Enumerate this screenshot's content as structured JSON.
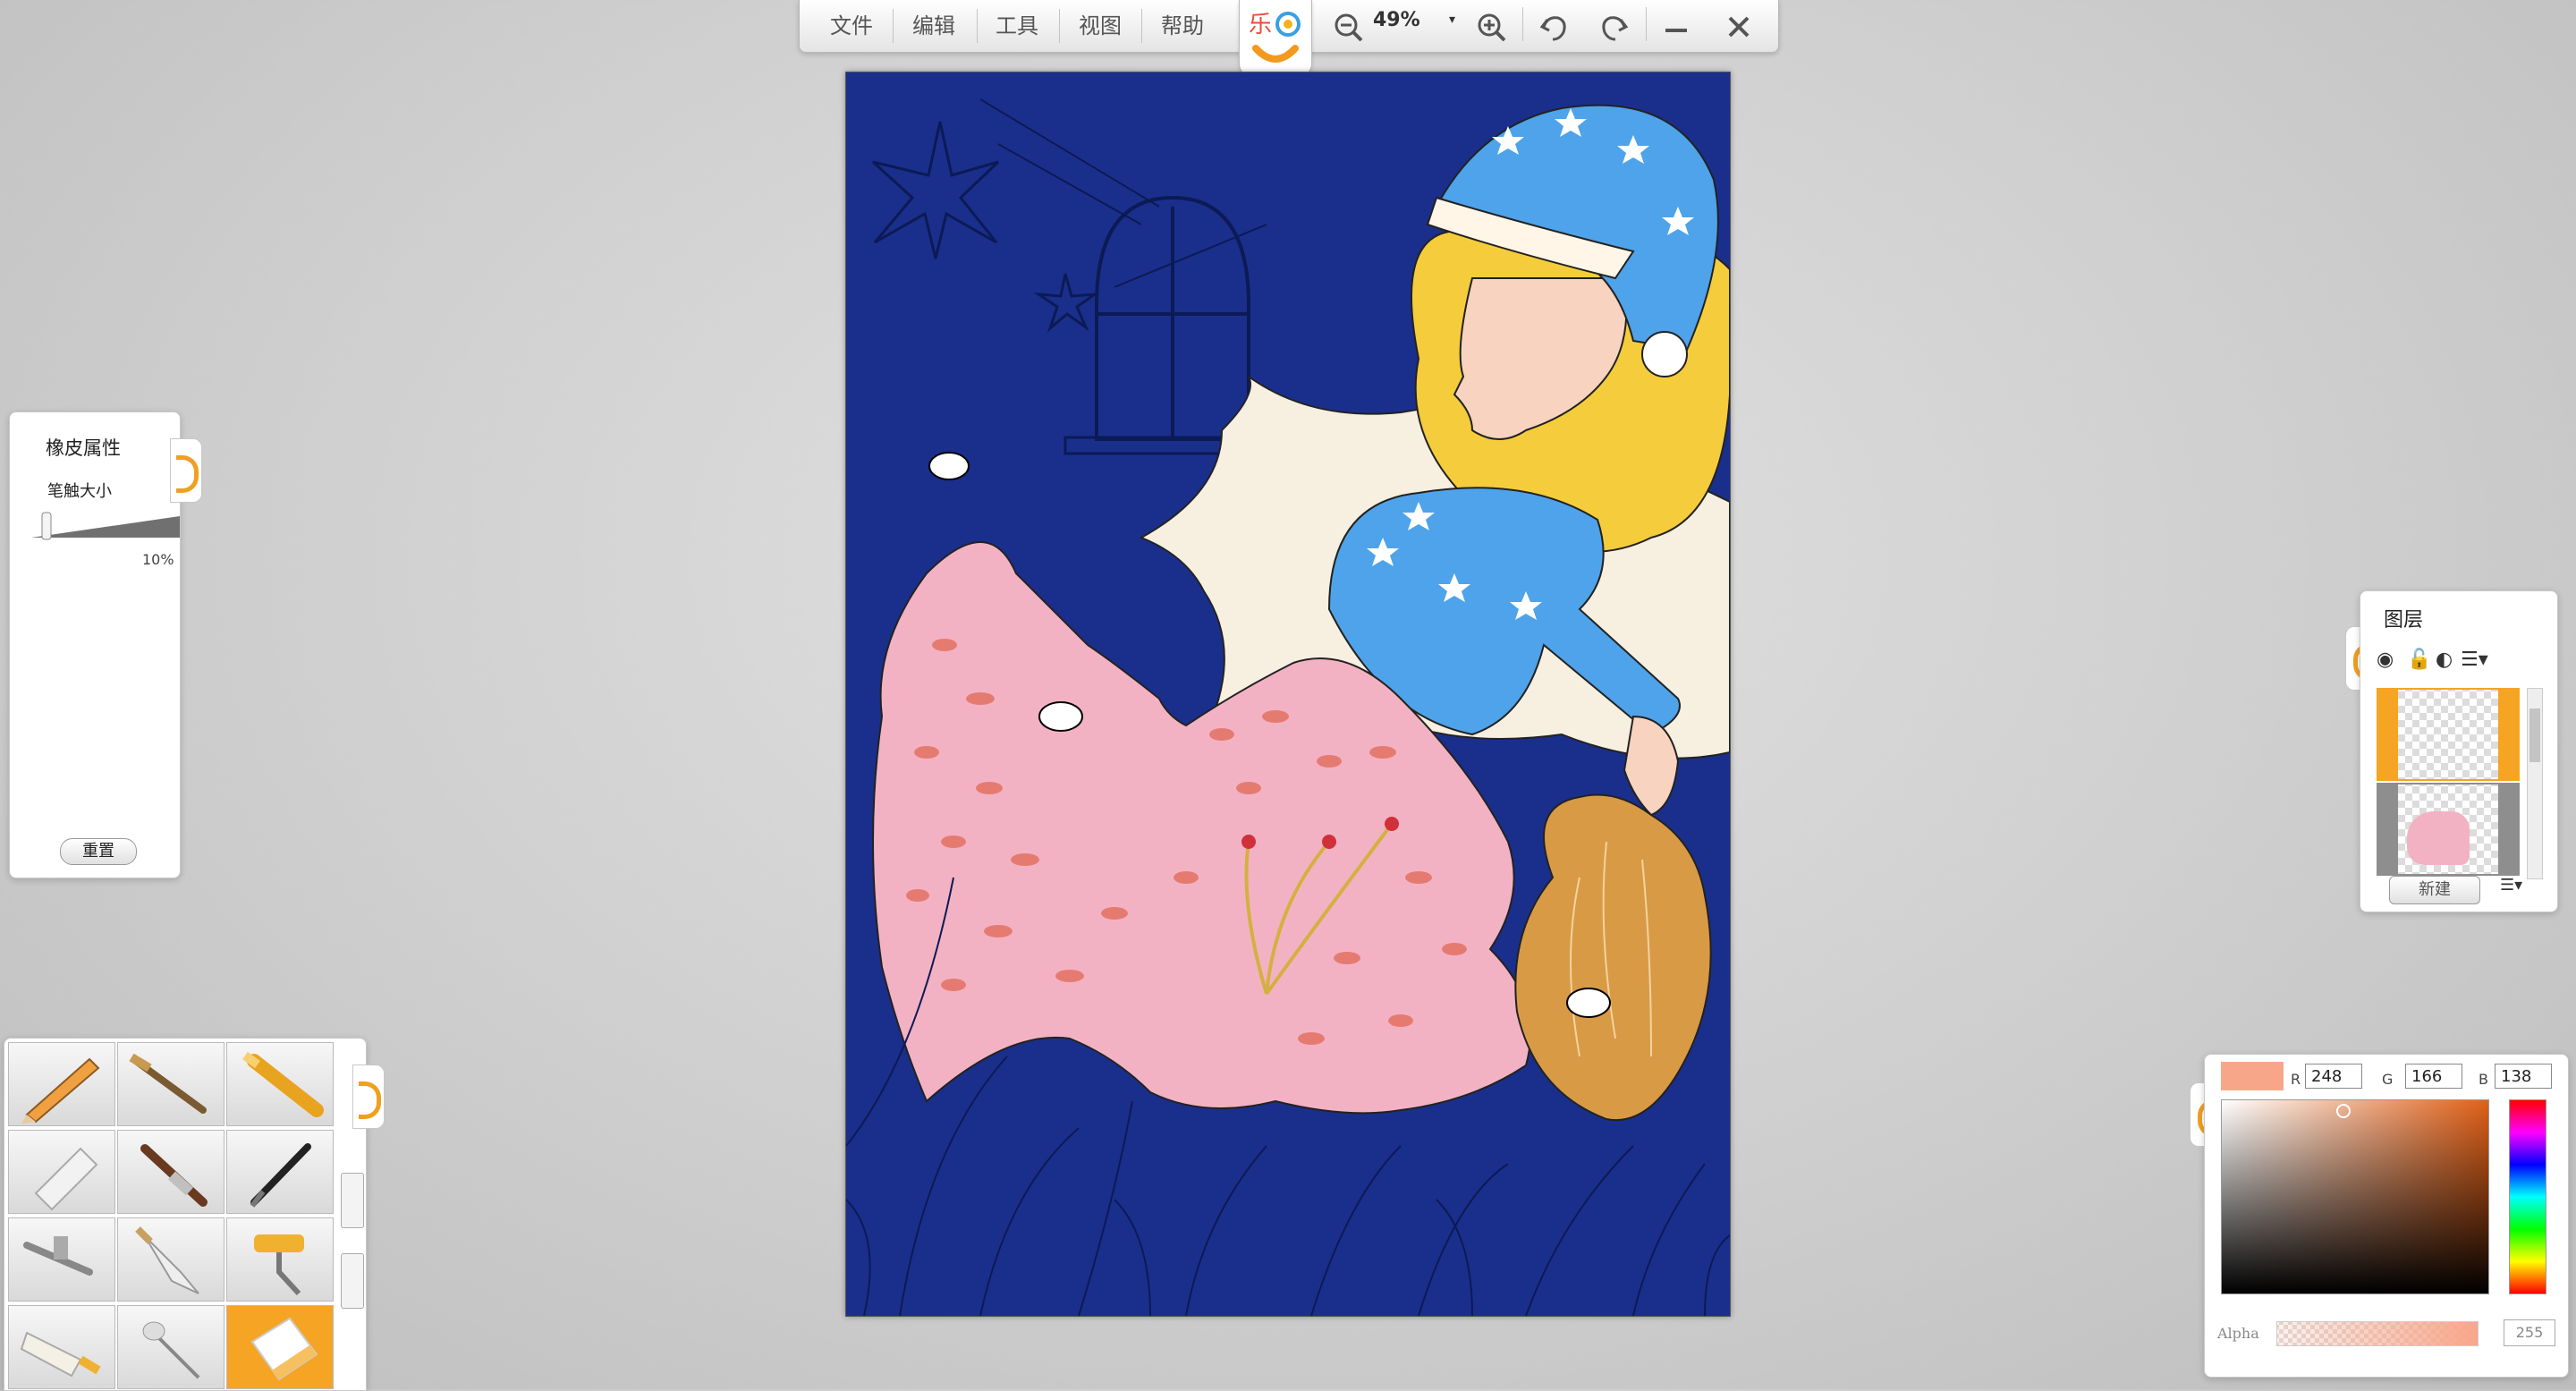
{
  "menu": {
    "file": "文件",
    "edit": "编辑",
    "tools": "工具",
    "view": "视图",
    "help": "帮助"
  },
  "toolbar": {
    "zoom": "49%",
    "icons": [
      "zoom-out-icon",
      "zoom-in-icon",
      "undo-icon",
      "redo-icon",
      "minimize-icon",
      "close-icon"
    ]
  },
  "eraser_panel": {
    "title": "橡皮属性",
    "brush_size_label": "笔触大小",
    "brush_size_value": "10%",
    "reset_label": "重置"
  },
  "tools": {
    "items": [
      "pencil",
      "flat-brush",
      "marker",
      "eraser-block",
      "fan-brush",
      "ink-brush",
      "airbrush",
      "palette-knife",
      "paint-roller",
      "paint-tube",
      "dropper",
      "eraser"
    ],
    "active": "eraser"
  },
  "layers_panel": {
    "title": "图层",
    "new_label": "新建"
  },
  "color_panel": {
    "current_color": "#f8a68a",
    "r_label": "R",
    "g_label": "G",
    "b_label": "B",
    "r": "248",
    "g": "166",
    "b": "138",
    "alpha_label": "Alpha",
    "alpha_value": "255"
  },
  "canvas": {
    "background": "#1a2f8c"
  }
}
